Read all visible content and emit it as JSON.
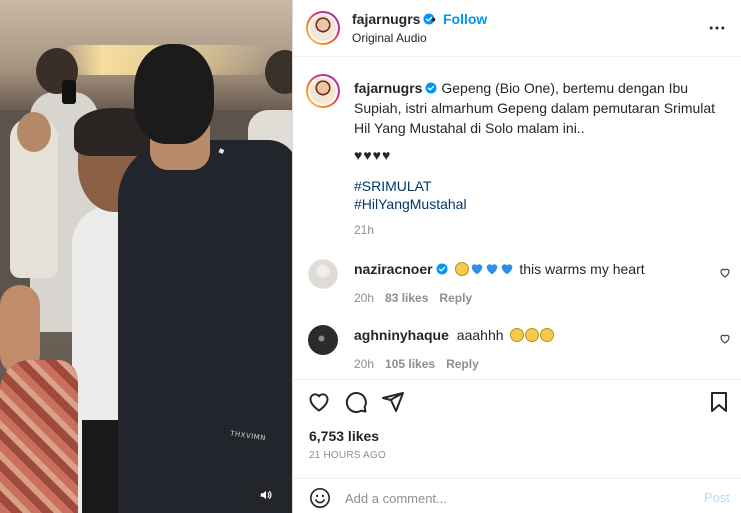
{
  "post": {
    "username": "fajarnugrs",
    "follow_label": "Follow",
    "separator": "•",
    "audio_label": "Original Audio",
    "more_icon": "more-horizontal-icon",
    "media_overlay": {
      "patch_text": "◆",
      "jacket_text": "THXVIMN"
    }
  },
  "caption": {
    "username": "fajarnugrs",
    "text": "Gepeng (Bio One), bertemu dengan Ibu Supiah, istri almarhum Gepeng dalam pemutaran Srimulat Hil Yang Mustahal di Solo malam ini..",
    "hearts": "♥♥♥♥",
    "hashtags": [
      "#SRIMULAT",
      "#HilYangMustahal"
    ],
    "time": "21h"
  },
  "comments": [
    {
      "username": "naziracnoer",
      "verified": true,
      "text": "this warms my heart",
      "emojis": [
        "pleading-face",
        "blue-heart",
        "blue-heart",
        "blue-heart"
      ],
      "time": "20h",
      "likes": "83 likes",
      "reply_label": "Reply"
    },
    {
      "username": "aghninyhaque",
      "verified": false,
      "text": "aaahhh",
      "emojis": [
        "sad-face",
        "sad-face",
        "sad-face"
      ],
      "time": "20h",
      "likes": "105 likes",
      "reply_label": "Reply"
    }
  ],
  "actions": {
    "likes": "6,753 likes",
    "time_ago": "21 HOURS AGO",
    "comment_placeholder": "Add a comment...",
    "post_label": "Post"
  },
  "colors": {
    "accent": "#0095f6",
    "hashtag": "#00376b",
    "secondary_text": "#8e8e8e",
    "post_disabled": "#b3dbff"
  }
}
